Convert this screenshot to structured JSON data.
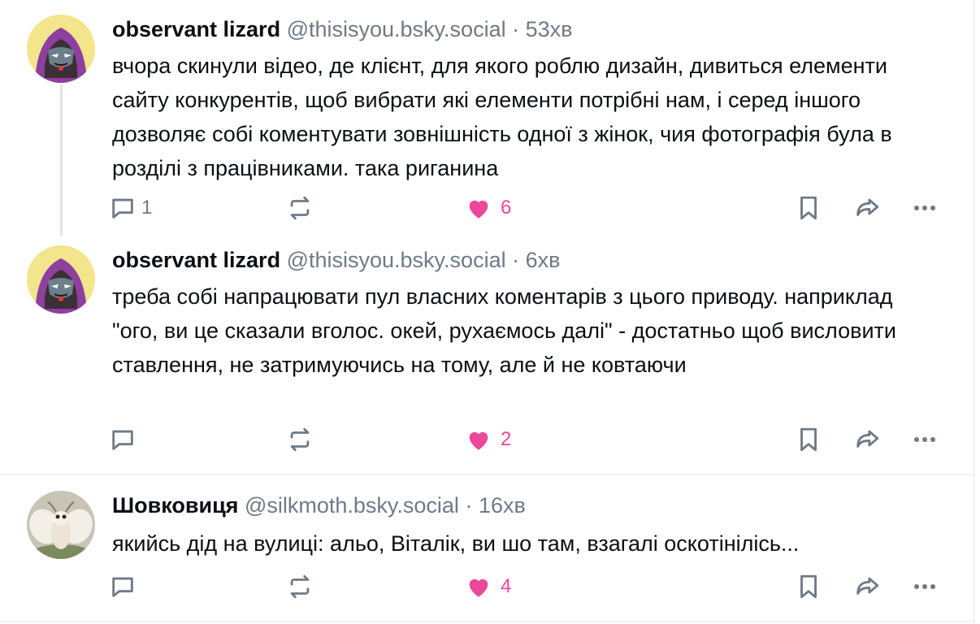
{
  "posts": [
    {
      "author": "observant lizard",
      "handle": "@thisisyou.bsky.social",
      "separator": "·",
      "time": "53хв",
      "text": "вчора скинули відео, де клієнт, для якого роблю дизайн, дивиться елементи сайту конкурентів, щоб вибрати які елементи потрібні нам, і серед іншого дозволяє собі коментувати зовнішність одної з жінок, чия фотографія була в розділі з працівниками. така риганина",
      "replies": "1",
      "likes": "6",
      "liked": true
    },
    {
      "author": "observant lizard",
      "handle": "@thisisyou.bsky.social",
      "separator": "·",
      "time": "6хв",
      "text": "треба собі напрацювати пул власних коментарів з цього приводу. наприклад \"ого, ви це сказали вголос. окей, рухаємось далі\" - достатньо щоб висловити ставлення, не затримуючись на тому, але й не ковтаючи",
      "replies": "",
      "likes": "2",
      "liked": true
    },
    {
      "author": "Шовковиця",
      "handle": "@silkmoth.bsky.social",
      "separator": "·",
      "time": "16хв",
      "text": "якийсь дід на вулиці: альо, Віталік, ви шо там, взагалі оскотінілісь...",
      "replies": "",
      "likes": "4",
      "liked": true
    }
  ],
  "icons": {
    "reply": "speech-bubble-icon",
    "repost": "repost-arrows-icon",
    "like": "heart-icon",
    "bookmark": "bookmark-icon",
    "share": "share-arrow-icon",
    "more": "more-dots-icon"
  },
  "colors": {
    "like": "#ec4899",
    "muted": "#6f7a85",
    "text": "#0b0f14",
    "border": "#e3e7ec"
  }
}
